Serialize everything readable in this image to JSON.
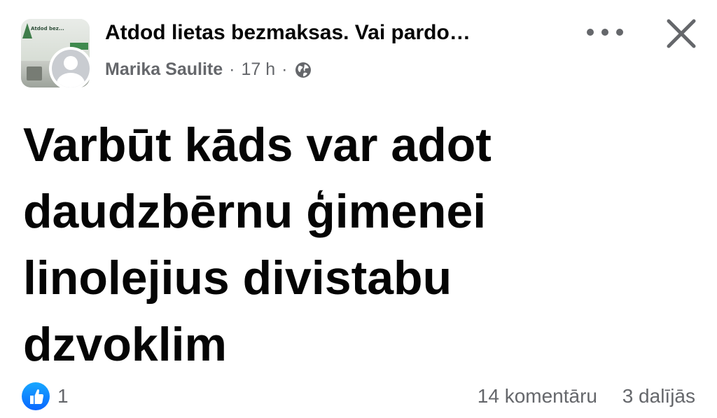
{
  "header": {
    "group_name": "Atdod lietas bezmaksas. Vai pardo…",
    "author": "Marika Saulite",
    "separator": "·",
    "time": "17 h",
    "privacy_icon": "globe-icon",
    "more_icon": "more-options-icon",
    "close_icon": "close-icon"
  },
  "group_thumb": {
    "sign_text": "Atdod bez..."
  },
  "post": {
    "lines": [
      "Varbūt kāds var adot",
      "daudzbērnu ģimenei",
      "linolejius divistabu",
      "dzvoklim"
    ]
  },
  "footer": {
    "reaction_icon": "like-icon",
    "reaction_count": "1",
    "comments": "14 komentāru",
    "shares": "3 dalījās"
  },
  "colors": {
    "text_primary": "#050505",
    "text_secondary": "#65676b",
    "like_blue": "#0866ff"
  }
}
